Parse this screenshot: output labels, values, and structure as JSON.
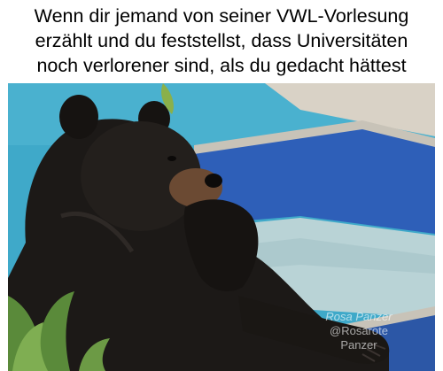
{
  "caption": {
    "lines": [
      "Wenn dir jemand von seiner VWL-Vorlesung",
      "erzählt und du feststellst, dass Universitäten",
      "noch verlorener sind, als du gedacht hättest"
    ]
  },
  "photo": {
    "subject": "bear-in-hot-tub",
    "colors": {
      "pool_water": "#3fa9c9",
      "spa_tiles": "#2e5fb8",
      "spa_water": "#b9d3d6",
      "deck": "#d9d2c6",
      "bear_fur": "#1c1917",
      "muzzle": "#6b4a33",
      "plant": "#5a8a3a"
    }
  },
  "watermark": {
    "logo": "Rosa Panzer",
    "handle": "@Rosarote",
    "name": "Panzer"
  }
}
